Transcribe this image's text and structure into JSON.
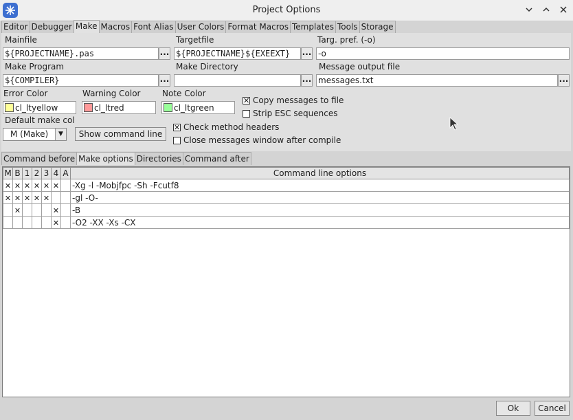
{
  "window": {
    "title": "Project Options",
    "controls": [
      "minimize",
      "maximize",
      "close"
    ]
  },
  "tabs": [
    "Editor",
    "Debugger",
    "Make",
    "Macros",
    "Font Alias",
    "User Colors",
    "Format Macros",
    "Templates",
    "Tools",
    "Storage"
  ],
  "active_tab": "Make",
  "make": {
    "mainfile_label": "Mainfile",
    "mainfile_value": "${PROJECTNAME}.pas",
    "targetfile_label": "Targetfile",
    "targetfile_value": "${PROJECTNAME}${EXEEXT}",
    "targpref_label": "Targ. pref. (-o)",
    "targpref_value": "-o",
    "makeprogram_label": "Make Program",
    "makeprogram_value": "${COMPILER}",
    "makedir_label": "Make Directory",
    "makedir_value": "",
    "msgout_label": "Message output file",
    "msgout_value": "messages.txt",
    "ellipsis": "...",
    "error_color_label": "Error Color",
    "error_color_value": "cl_ltyellow",
    "error_color_hex": "#ffff99",
    "warning_color_label": "Warning Color",
    "warning_color_value": "cl_ltred",
    "warning_color_hex": "#ff9999",
    "note_color_label": "Note Color",
    "note_color_value": "cl_ltgreen",
    "note_color_hex": "#99ff99",
    "copy_messages_label": "Copy messages to file",
    "copy_messages_checked": true,
    "strip_esc_label": "Strip ESC sequences",
    "strip_esc_checked": false,
    "default_make_label": "Default make col",
    "default_make_value": "M (Make)",
    "show_cmd_label": "Show command line",
    "check_method_label": "Check method headers",
    "check_method_checked": true,
    "close_messages_label": "Close messages window after compile",
    "close_messages_checked": false
  },
  "subtabs": [
    "Command before",
    "Make options",
    "Directories",
    "Command after"
  ],
  "active_subtab": "Make options",
  "grid": {
    "columns": [
      "M",
      "B",
      "1",
      "2",
      "3",
      "4",
      "A",
      "Command line options"
    ],
    "rows": [
      {
        "flags": [
          "x",
          "x",
          "x",
          "x",
          "x",
          "x",
          ""
        ],
        "options": "-Xg -l -Mobjfpc -Sh -Fcutf8"
      },
      {
        "flags": [
          "x",
          "x",
          "x",
          "x",
          "x",
          "",
          ""
        ],
        "options": "-gl -O-"
      },
      {
        "flags": [
          "",
          "x",
          "",
          "",
          "",
          "x",
          ""
        ],
        "options": "-B"
      },
      {
        "flags": [
          "",
          "",
          "",
          "",
          "",
          "x",
          ""
        ],
        "options": "-O2 -XX -Xs -CX"
      }
    ]
  },
  "buttons": {
    "ok": "Ok",
    "cancel": "Cancel"
  }
}
